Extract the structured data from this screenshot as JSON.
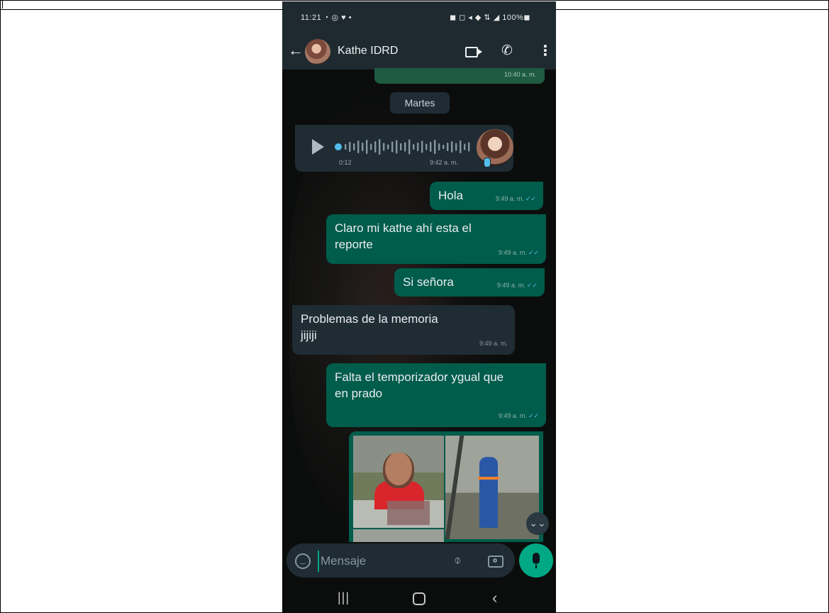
{
  "status_bar": {
    "time": "11:21 ◔ ◎ ♥ •",
    "right": "◼ ◻ ◂ ◆ ⇅ ◢ 100%◼"
  },
  "chat_header": {
    "contact_name": "Kathe IDRD"
  },
  "previous_message": {
    "time": "10:40 a. m."
  },
  "date_chip": "Martes",
  "voice_note": {
    "duration": "0:12",
    "time": "9:42 a. m."
  },
  "messages": [
    {
      "direction": "out",
      "text": "Hola",
      "time": "9:49 a. m."
    },
    {
      "direction": "out",
      "text": "Claro mi kathe ahí esta el reporte",
      "time": "9:49 a. m."
    },
    {
      "direction": "out",
      "text": "Si señora",
      "time": "9:49 a. m."
    },
    {
      "direction": "in",
      "text": "Problemas de la memoria jijiji",
      "time": "9:49 a. m."
    },
    {
      "direction": "out",
      "text": "Falta el temporizador ygual que en prado",
      "time": "9:49 a. m."
    }
  ],
  "composer": {
    "placeholder": "Mensaje"
  },
  "nav": {
    "recents": "|||",
    "back": "‹"
  },
  "icons": {
    "back": "arrow-left",
    "video": "video-camera",
    "call": "phone",
    "menu": "more-vertical",
    "play": "play",
    "emoji": "smiley",
    "attach": "paperclip",
    "camera": "camera",
    "mic": "microphone",
    "scroll": "double-chevron-down"
  },
  "colors": {
    "header": "#1e2a30",
    "outgoing": "#005c4b",
    "incoming": "#1f2c34",
    "accent": "#00a884",
    "read_checks": "#53bdeb"
  }
}
